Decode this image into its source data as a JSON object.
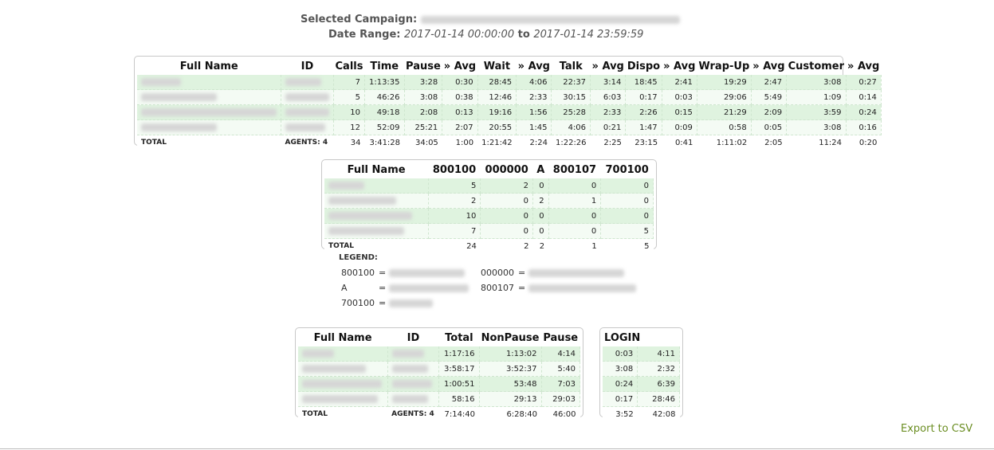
{
  "header": {
    "campaign_label": "Selected Campaign:",
    "date_label": "Date Range:",
    "date_from": "2017-01-14 00:00:00",
    "date_to_word": "to",
    "date_to": "2017-01-14 23:59:59"
  },
  "table1": {
    "columns": [
      "Full Name",
      "ID",
      "Calls",
      "Time",
      "Pause",
      "» Avg",
      "Wait",
      "» Avg",
      "Talk",
      "» Avg",
      "Dispo",
      "» Avg",
      "Wrap-Up",
      "» Avg",
      "Customer",
      "» Avg"
    ],
    "rows": [
      [
        "",
        "",
        "7",
        "1:13:35",
        "3:28",
        "0:30",
        "28:45",
        "4:06",
        "22:37",
        "3:14",
        "18:45",
        "2:41",
        "19:29",
        "2:47",
        "3:08",
        "0:27"
      ],
      [
        "",
        "",
        "5",
        "46:26",
        "3:08",
        "0:38",
        "12:46",
        "2:33",
        "30:15",
        "6:03",
        "0:17",
        "0:03",
        "29:06",
        "5:49",
        "1:09",
        "0:14"
      ],
      [
        "",
        "",
        "10",
        "49:18",
        "2:08",
        "0:13",
        "19:16",
        "1:56",
        "25:28",
        "2:33",
        "2:26",
        "0:15",
        "21:29",
        "2:09",
        "3:59",
        "0:24"
      ],
      [
        "",
        "",
        "12",
        "52:09",
        "25:21",
        "2:07",
        "20:55",
        "1:45",
        "4:06",
        "0:21",
        "1:47",
        "0:09",
        "0:58",
        "0:05",
        "3:08",
        "0:16"
      ]
    ],
    "total": [
      "TOTAL",
      "AGENTS: 4",
      "34",
      "3:41:28",
      "34:05",
      "1:00",
      "1:21:42",
      "2:24",
      "1:22:26",
      "2:25",
      "23:15",
      "0:41",
      "1:11:02",
      "2:05",
      "11:24",
      "0:20"
    ]
  },
  "table2": {
    "columns": [
      "Full Name",
      "800100",
      "000000",
      "A",
      "800107",
      "700100"
    ],
    "rows": [
      [
        "",
        "5",
        "2",
        "0",
        "0",
        "0"
      ],
      [
        "",
        "2",
        "0",
        "2",
        "1",
        "0"
      ],
      [
        "",
        "10",
        "0",
        "0",
        "0",
        "0"
      ],
      [
        "",
        "7",
        "0",
        "0",
        "0",
        "5"
      ]
    ],
    "total": [
      "TOTAL",
      "24",
      "2",
      "2",
      "1",
      "5"
    ]
  },
  "legend": {
    "title": "LEGEND:",
    "items": [
      {
        "code": "800100",
        "eq": "="
      },
      {
        "code": "000000",
        "eq": "="
      },
      {
        "code": "A",
        "eq": "="
      },
      {
        "code": "800107",
        "eq": "="
      },
      {
        "code": "700100",
        "eq": "="
      }
    ]
  },
  "table3": {
    "columns": [
      "Full Name",
      "ID",
      "Total",
      "NonPause",
      "Pause"
    ],
    "rows": [
      [
        "",
        "",
        "1:17:16",
        "1:13:02",
        "4:14"
      ],
      [
        "",
        "",
        "3:58:17",
        "3:52:37",
        "5:40"
      ],
      [
        "",
        "",
        "1:00:51",
        "53:48",
        "7:03"
      ],
      [
        "",
        "",
        "58:16",
        "29:13",
        "29:03"
      ]
    ],
    "total": [
      "TOTAL",
      "AGENTS: 4",
      "7:14:40",
      "6:28:40",
      "46:00"
    ]
  },
  "table4": {
    "columns": [
      "LOGIN"
    ],
    "rows": [
      [
        "0:03",
        "4:11"
      ],
      [
        "3:08",
        "2:32"
      ],
      [
        "0:24",
        "6:39"
      ],
      [
        "0:17",
        "28:46"
      ]
    ],
    "total": [
      "3:52",
      "42:08"
    ]
  },
  "export_label": "Export to CSV"
}
